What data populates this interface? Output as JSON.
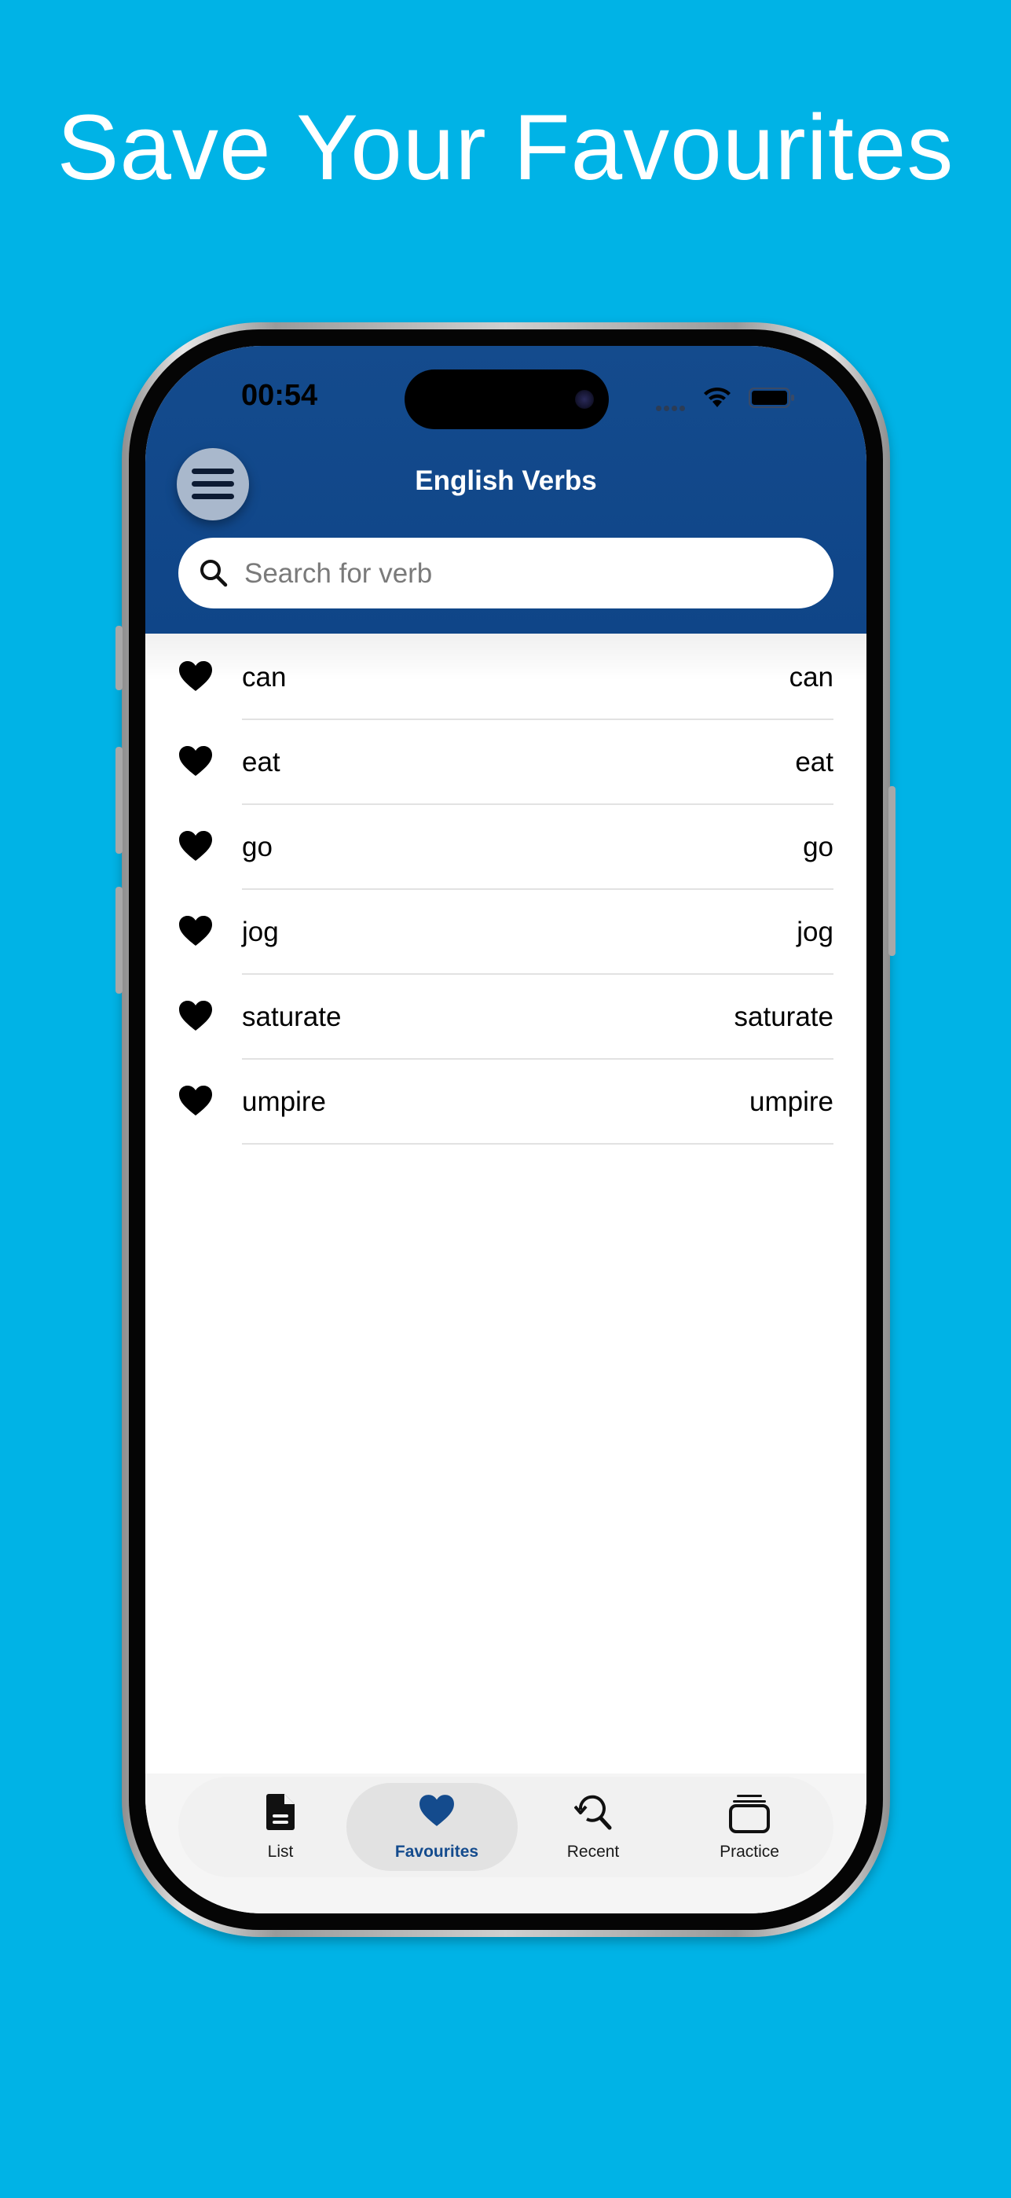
{
  "headline": "Save Your Favourites",
  "status_bar": {
    "time": "00:54"
  },
  "header": {
    "title": "English Verbs",
    "menu_icon": "hamburger-menu-icon"
  },
  "search": {
    "placeholder": "Search for verb",
    "value": ""
  },
  "favourites": [
    {
      "term": "can",
      "translation": "can"
    },
    {
      "term": "eat",
      "translation": "eat"
    },
    {
      "term": "go",
      "translation": "go"
    },
    {
      "term": "jog",
      "translation": "jog"
    },
    {
      "term": "saturate",
      "translation": "saturate"
    },
    {
      "term": "umpire",
      "translation": "umpire"
    }
  ],
  "tabs": [
    {
      "label": "List",
      "icon": "document-icon",
      "active": false
    },
    {
      "label": "Favourites",
      "icon": "heart-icon",
      "active": true
    },
    {
      "label": "Recent",
      "icon": "search-history-icon",
      "active": false
    },
    {
      "label": "Practice",
      "icon": "cards-stack-icon",
      "active": false
    }
  ],
  "colors": {
    "background": "#00b3e6",
    "header": "#144b8d",
    "active_tab": "#144b8d"
  }
}
